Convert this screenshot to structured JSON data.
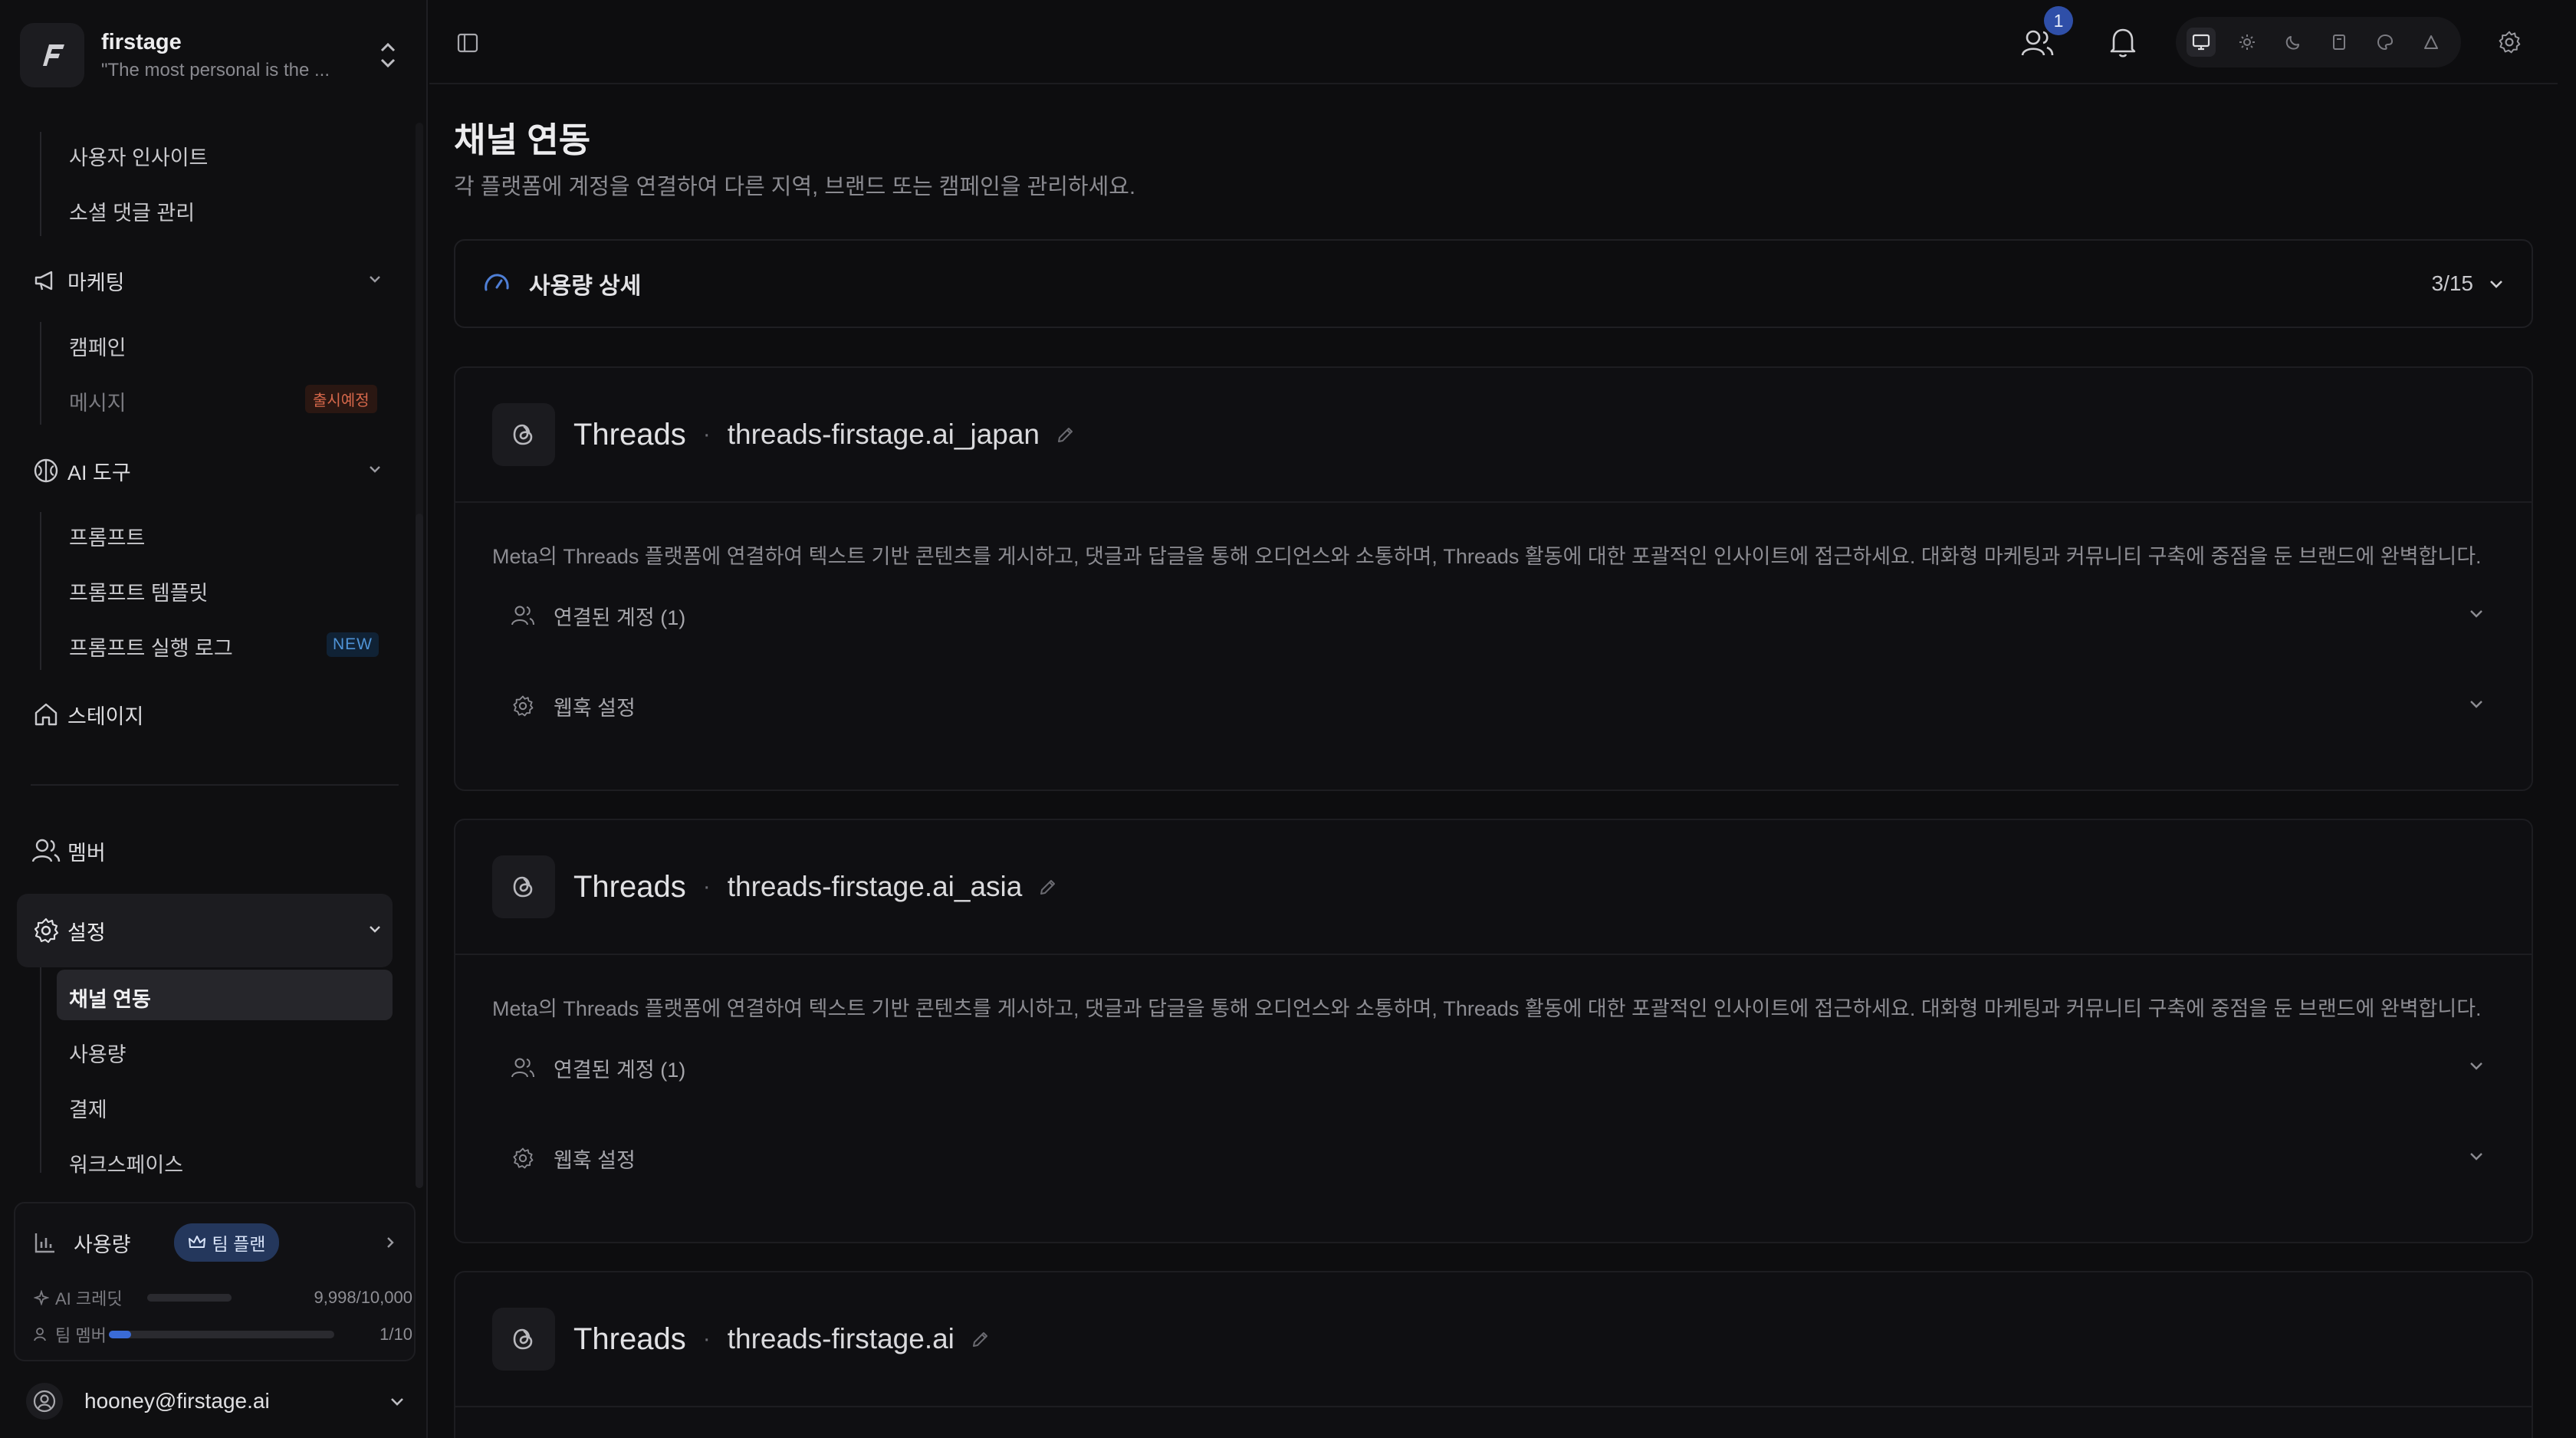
{
  "workspace": {
    "name": "firstage",
    "tagline": "\"The most personal is the ..."
  },
  "sidebar": {
    "items_top": [
      "사용자 인사이트",
      "소셜 댓글 관리"
    ],
    "marketing": {
      "label": "마케팅",
      "items": [
        "캠페인",
        "메시지"
      ],
      "soon_badge": "출시예정"
    },
    "ai_tools": {
      "label": "AI 도구",
      "items": [
        "프롬프트",
        "프롬프트 템플릿",
        "프롬프트 실행 로그"
      ],
      "new_badge": "NEW"
    },
    "stage": "스테이지",
    "members": "멤버",
    "settings": {
      "label": "설정",
      "items": [
        "채널 연동",
        "사용량",
        "결제",
        "워크스페이스"
      ]
    }
  },
  "usage": {
    "label": "사용량",
    "plan": "팀 플랜",
    "credits": {
      "label": "AI 크레딧",
      "value": "9,998/10,000",
      "fill": 0.9998
    },
    "members": {
      "label": "팀 멤버",
      "value": "1/10",
      "fill": 0.1
    }
  },
  "user": {
    "email": "hooney@firstage.ai"
  },
  "topbar": {
    "notification_count": "1"
  },
  "page": {
    "title": "채널 연동",
    "description": "각 플랫폼에 계정을 연결하여 다른 지역, 브랜드 또는 캠페인을 관리하세요.",
    "usage_detail": {
      "label": "사용량 상세",
      "value": "3/15"
    }
  },
  "channels": [
    {
      "platform": "Threads",
      "account": "threads-firstage.ai_japan",
      "description": "Meta의 Threads 플랫폼에 연결하여 텍스트 기반 콘텐츠를 게시하고, 댓글과 답글을 통해 오디언스와 소통하며, Threads 활동에 대한 포괄적인 인사이트에 접근하세요. 대화형 마케팅과 커뮤니티 구축에 중점을 둔 브랜드에 완벽합니다.",
      "connected_label": "연결된 계정 (1)",
      "webhook_label": "웹훅 설정"
    },
    {
      "platform": "Threads",
      "account": "threads-firstage.ai_asia",
      "description": "Meta의 Threads 플랫폼에 연결하여 텍스트 기반 콘텐츠를 게시하고, 댓글과 답글을 통해 오디언스와 소통하며, Threads 활동에 대한 포괄적인 인사이트에 접근하세요. 대화형 마케팅과 커뮤니티 구축에 중점을 둔 브랜드에 완벽합니다.",
      "connected_label": "연결된 계정 (1)",
      "webhook_label": "웹훅 설정"
    },
    {
      "platform": "Threads",
      "account": "threads-firstage.ai"
    }
  ],
  "colors": {
    "accent": "#3a6bd6",
    "background": "#0d0d0f",
    "badge_soon": "#d5674a",
    "badge_new": "#4f93d6"
  }
}
